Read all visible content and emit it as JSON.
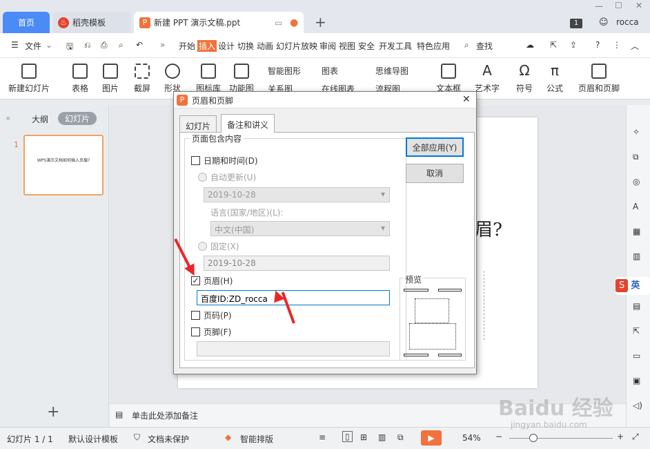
{
  "tabs": {
    "home": "首页",
    "template": "稻壳模板",
    "doc": "新建 PPT 演示文稿.ppt",
    "user": "rocca",
    "badge": "1"
  },
  "menu": {
    "file": "文件",
    "items": [
      "开始",
      "插入",
      "设计",
      "切换",
      "动画",
      "幻灯片放映",
      "审阅",
      "视图",
      "安全",
      "开发工具",
      "特色应用"
    ],
    "search": "查找"
  },
  "ribbon": {
    "buttons": [
      "新建幻灯片",
      "表格",
      "图片",
      "截屏",
      "形状",
      "图标库",
      "功能图",
      "智能图形",
      "图表",
      "关系图",
      "在线图表",
      "思维导图",
      "流程图",
      "文本框",
      "艺术字",
      "符号",
      "公式",
      "页眉和页脚"
    ]
  },
  "left_panel": {
    "tab_outline": "大纲",
    "tab_slides": "幻灯片",
    "slide_num": "1",
    "thumb_text": "WPS演示文档如何插入页眉?"
  },
  "slide": {
    "title_fragment": "眉?"
  },
  "notes": {
    "placeholder": "单击此处添加备注"
  },
  "status": {
    "slide_pos": "幻灯片 1 / 1",
    "template": "默认设计模板",
    "protect": "文档未保护",
    "smart": "智能排版",
    "zoom": "54%"
  },
  "dialog": {
    "title": "页眉和页脚",
    "tab_slide": "幻灯片",
    "tab_notes": "备注和讲义",
    "group_label": "页面包含内容",
    "datetime": "日期和时间(D)",
    "auto_update": "自动更新(U)",
    "date_value": "2019-10-28",
    "language_label": "语言(国家/地区)(L):",
    "language_value": "中文(中国)",
    "fixed": "固定(X)",
    "fixed_value": "2019-10-28",
    "header": "页眉(H)",
    "header_value": "百度ID:ZD_rocca",
    "page_number": "页码(P)",
    "footer": "页脚(F)",
    "apply_all": "全部应用(Y)",
    "cancel": "取消",
    "preview": "预览"
  },
  "watermark": {
    "brand": "Baidu 经验",
    "url": "jingyan.baidu.com"
  },
  "colors": {
    "accent": "#4a8bf5",
    "ppt": "#f0723c",
    "arrow": "#e8262a"
  }
}
